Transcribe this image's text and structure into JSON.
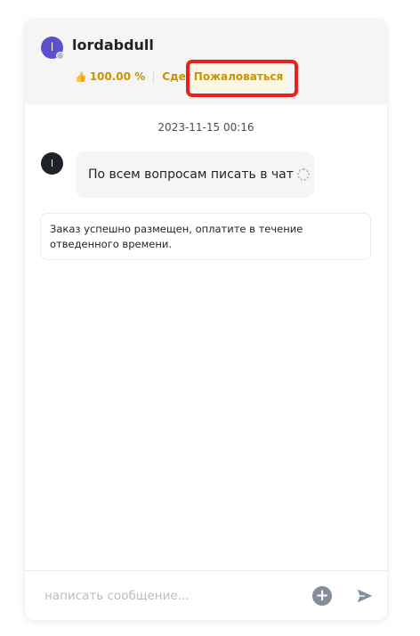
{
  "header": {
    "avatar_letter": "l",
    "username": "lordabdull",
    "rating": "100.00 %",
    "trades_label": "Сделки",
    "report_label": "Пожаловаться"
  },
  "chat": {
    "timestamp": "2023-11-15 00:16",
    "messages": [
      {
        "avatar_letter": "l",
        "text": "По всем вопросам писать в чат"
      }
    ],
    "system_notice": "Заказ успешно размещен, оплатите в течение отведенного времени."
  },
  "composer": {
    "placeholder": "написать сообщение..."
  },
  "icons": {
    "thumb": "thumbs-up-icon",
    "attach": "plus-circle-icon",
    "send": "send-icon",
    "pending": "loading-icon"
  },
  "colors": {
    "accent": "#c99400",
    "positive": "#2ebd85",
    "highlight": "#e8201e",
    "avatar_user": "#5b4fcf",
    "avatar_msg": "#1e2329"
  }
}
